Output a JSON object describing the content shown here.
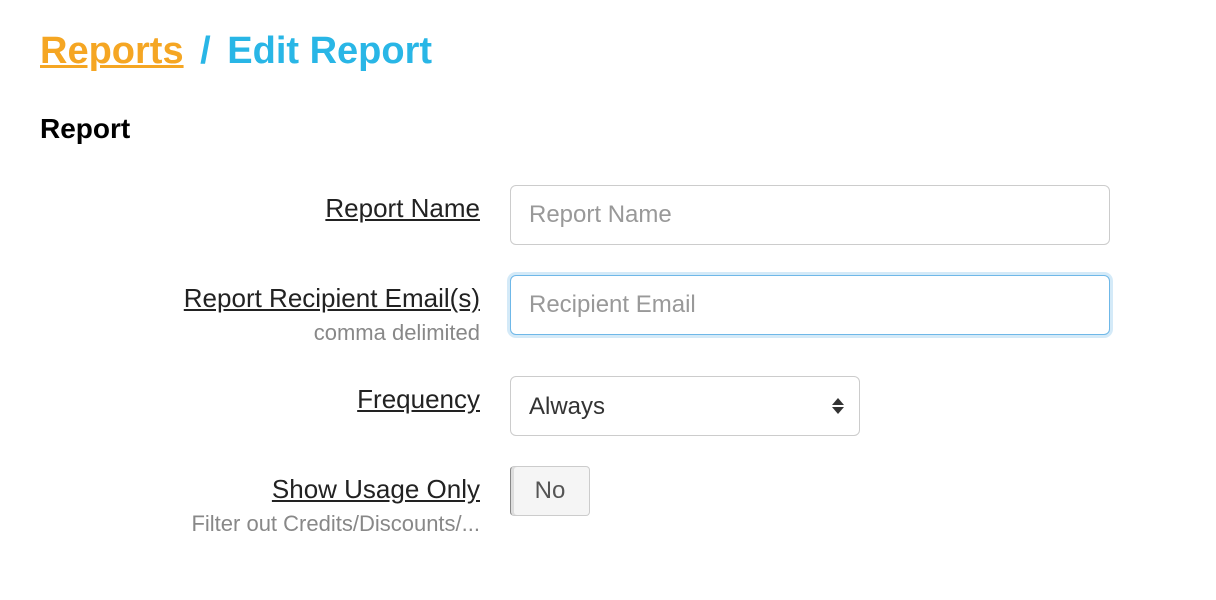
{
  "breadcrumb": {
    "parent": "Reports",
    "separator": "/",
    "current": "Edit Report"
  },
  "section": {
    "title": "Report"
  },
  "fields": {
    "report_name": {
      "label": "Report Name",
      "placeholder": "Report Name",
      "value": ""
    },
    "recipient_emails": {
      "label": "Report Recipient Email(s)",
      "sublabel": "comma delimited",
      "placeholder": "Recipient Email",
      "value": ""
    },
    "frequency": {
      "label": "Frequency",
      "selected": "Always"
    },
    "show_usage_only": {
      "label": "Show Usage Only",
      "sublabel": "Filter out Credits/Discounts/...",
      "value": "No"
    }
  }
}
